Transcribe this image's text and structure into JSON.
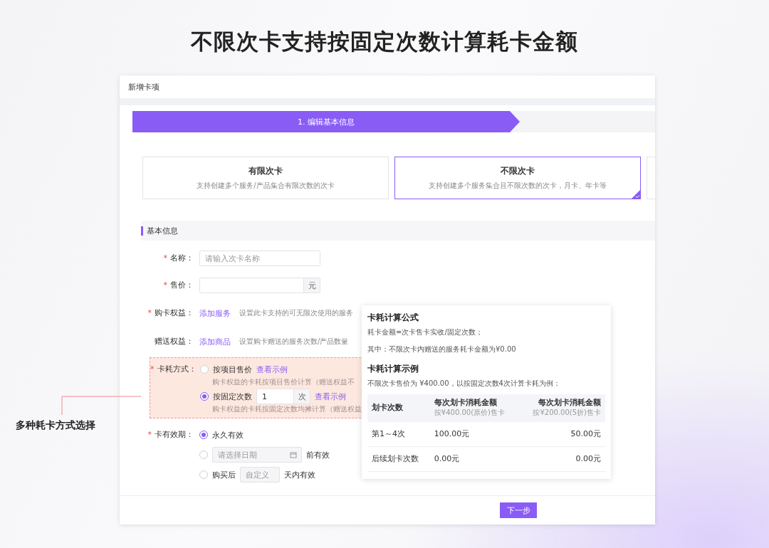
{
  "headline": "不限次卡支持按固定次数计算耗卡金额",
  "window": {
    "title": "新增卡项"
  },
  "step": {
    "label": "1. 编辑基本信息"
  },
  "card_types": [
    {
      "title": "有限次卡",
      "description": "支持创建多个服务/产品集合有限次数的次卡",
      "selected": false
    },
    {
      "title": "不限次卡",
      "description": "支持创建多个服务集合且不限次数的次卡，月卡、年卡等",
      "selected": true
    }
  ],
  "section": {
    "title": "基本信息"
  },
  "fields": [
    {
      "kind": "text",
      "required_mark": "*",
      "label": "名称：",
      "placeholder": "请输入次卡名称"
    },
    {
      "kind": "price",
      "required_mark": "*",
      "label": "售价：",
      "suffix": "元"
    },
    {
      "kind": "link",
      "required_mark": "*",
      "label": "购卡权益：",
      "link": "添加服务",
      "hint": "设置此卡支持的可无限次使用的服务"
    },
    {
      "kind": "link",
      "label": "赠送权益：",
      "link": "添加商品",
      "hint": "设置购卡赠送的服务次数/产品数量"
    },
    {
      "kind": "consumption",
      "required_mark": "*",
      "label": "卡耗方式：",
      "highlighted": true,
      "options": [
        {
          "label": "按项目售价",
          "link": "查看示例",
          "hint": "购卡权益的卡耗按项目售价计算（赠送权益不",
          "selected": false
        },
        {
          "label": "按固定次数",
          "value": "1",
          "unit": "次",
          "link": "查看示例",
          "hint": "购卡权益的卡耗按固定次数均摊计算（赠送权益",
          "selected": true
        }
      ]
    },
    {
      "kind": "validity",
      "required_mark": "*",
      "label": "卡有效期：",
      "options": [
        {
          "label": "永久有效",
          "selected": true
        },
        {
          "placeholder": "请选择日期",
          "after": "前有效",
          "selected": false
        },
        {
          "before": "购买后",
          "placeholder": "自定义",
          "after": "天内有效",
          "selected": false
        }
      ]
    }
  ],
  "popover": {
    "title": "卡耗计算公式",
    "formula": "耗卡金额=次卡售卡实收/固定次数；",
    "note": "其中：不限次卡内赠送的服务耗卡金额为¥0.00",
    "example_title": "卡耗计算示例",
    "example_intro": "不限次卡售价为 ¥400.00，以按固定次数4次计算卡耗为例：",
    "table": {
      "columns": [
        {
          "label": "划卡次数"
        },
        {
          "label": "每次划卡消耗金额",
          "sub": "按¥400.00(原价)售卡"
        },
        {
          "label": "每次划卡消耗金额",
          "sub": "按¥200.00(5折)售卡"
        }
      ],
      "rows": [
        [
          "第1～4次",
          "100.00元",
          "50.00元"
        ],
        [
          "后续划卡次数",
          "0.00元",
          "0.00元"
        ]
      ]
    }
  },
  "footer": {
    "button": "下一步"
  },
  "annotation": {
    "label": "多种耗卡方式选择"
  }
}
